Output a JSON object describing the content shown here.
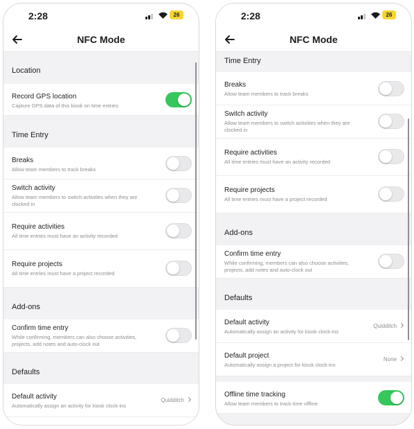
{
  "status": {
    "time": "2:28",
    "battery": "26"
  },
  "nav": {
    "title": "NFC Mode"
  },
  "sections": {
    "location": "Location",
    "time_entry": "Time Entry",
    "addons": "Add-ons",
    "defaults": "Defaults"
  },
  "settings": {
    "record_gps": {
      "title": "Record GPS location",
      "sub": "Capture GPS data of this kiosk on time entries",
      "on": true
    },
    "breaks": {
      "title": "Breaks",
      "sub": "Allow team members to track breaks",
      "on": false
    },
    "switch_activity": {
      "title": "Switch activity",
      "sub": "Allow team members to switch activities when they are clocked in",
      "on": false
    },
    "require_activities": {
      "title": "Require activities",
      "sub": "All time entries must have an activity recorded",
      "on": false
    },
    "require_projects": {
      "title": "Require projects",
      "sub": "All time entries must have a project recorded",
      "on": false
    },
    "confirm_time_entry": {
      "title": "Confirm time entry",
      "sub": "While confirming, members can also choose activities, projects, add notes and auto-clock out",
      "on": false
    },
    "default_activity": {
      "title": "Default activity",
      "sub": "Automatically assign an activity for kiosk clock-ins",
      "value": "Quidditch"
    },
    "default_project": {
      "title": "Default project",
      "sub": "Automatically assign a project for kiosk clock-ins",
      "value": "None"
    },
    "offline_tracking": {
      "title": "Offline time tracking",
      "sub": "Allow team members to track time offline",
      "on": true
    }
  },
  "colors": {
    "toggle_on": "#34c759",
    "toggle_off": "#e9e9eb",
    "battery": "#f7d531"
  },
  "icons": {
    "back": "arrow-left-icon",
    "chevron": "chevron-right-icon"
  }
}
